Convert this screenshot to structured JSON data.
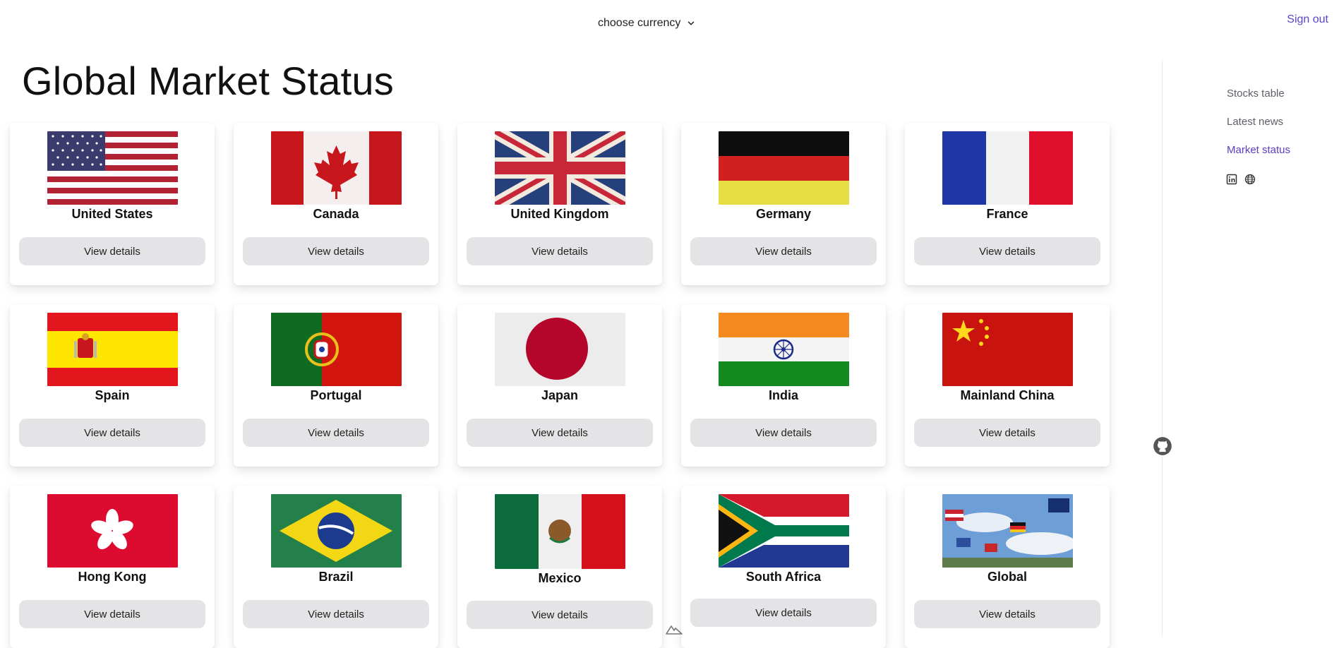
{
  "header": {
    "currency_label": "choose currency",
    "sign_out": "Sign out"
  },
  "page_title": "Global Market Status",
  "markets": [
    {
      "name": "United States",
      "button": "View details",
      "flag": "us-flag"
    },
    {
      "name": "Canada",
      "button": "View details",
      "flag": "canada-flag"
    },
    {
      "name": "United Kingdom",
      "button": "View details",
      "flag": "uk-flag"
    },
    {
      "name": "Germany",
      "button": "View details",
      "flag": "germany-flag"
    },
    {
      "name": "France",
      "button": "View details",
      "flag": "france-flag"
    },
    {
      "name": "Spain",
      "button": "View details",
      "flag": "spain-flag"
    },
    {
      "name": "Portugal",
      "button": "View details",
      "flag": "portugal-flag"
    },
    {
      "name": "Japan",
      "button": "View details",
      "flag": "japan-flag"
    },
    {
      "name": "India",
      "button": "View details",
      "flag": "india-flag"
    },
    {
      "name": "Mainland China",
      "button": "View details",
      "flag": "china-flag"
    },
    {
      "name": "Hong Kong",
      "button": "View details",
      "flag": "hong-kong-flag"
    },
    {
      "name": "Brazil",
      "button": "View details",
      "flag": "brazil-flag"
    },
    {
      "name": "Mexico",
      "button": "View details",
      "flag": "mexico-flag"
    },
    {
      "name": "South Africa",
      "button": "View details",
      "flag": "south-africa-flag"
    },
    {
      "name": "Global",
      "button": "View details",
      "flag": "global-flags-image"
    }
  ],
  "sidebar": {
    "items": [
      {
        "label": "Stocks table",
        "active": false
      },
      {
        "label": "Latest news",
        "active": false
      },
      {
        "label": "Market status",
        "active": true
      }
    ],
    "icons": [
      "linkedin-icon",
      "globe-icon"
    ]
  },
  "colors": {
    "accent": "#5b3cc4",
    "button_bg": "#e4e4e7",
    "sign_out": "#5b44c9"
  }
}
